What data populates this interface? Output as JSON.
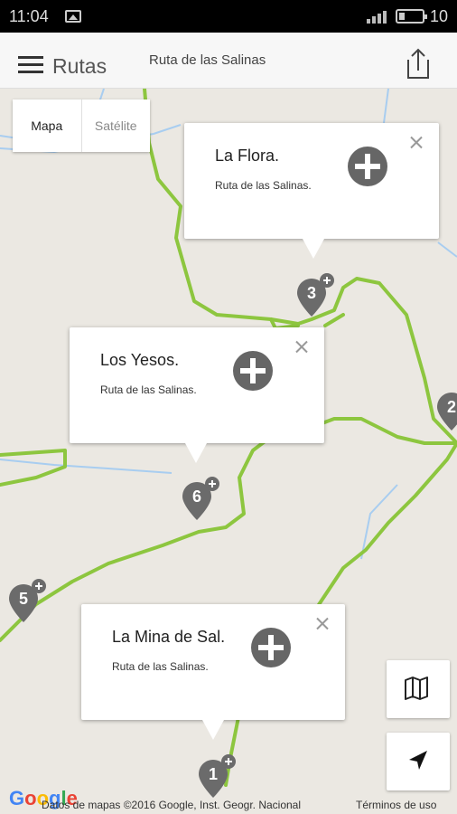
{
  "status": {
    "time": "11:04",
    "battery": "10"
  },
  "app_bar": {
    "title": "Rutas",
    "subtitle": "Ruta de las Salinas"
  },
  "map_type": {
    "map_label": "Mapa",
    "satellite_label": "Satélite",
    "selected": "Mapa"
  },
  "info_windows": [
    {
      "title": "La Flora.",
      "subtitle": "Ruta de las Salinas."
    },
    {
      "title": "Los Yesos.",
      "subtitle": "Ruta de las Salinas."
    },
    {
      "title": "La Mina de Sal.",
      "subtitle": "Ruta de las Salinas."
    }
  ],
  "markers": [
    "1",
    "2",
    "3",
    "5",
    "6"
  ],
  "footer": {
    "google_logo": "Google",
    "attribution": "Datos de mapas ©2016 Google, Inst. Geogr. Nacional",
    "terms": "Términos de uso"
  },
  "icons": {
    "menu": "menu-icon",
    "share": "share-icon",
    "map_layers": "map-icon",
    "my_location": "navigation-arrow-icon",
    "add": "plus-circle-icon",
    "close": "close-icon"
  },
  "colors": {
    "route": "#8dc63f",
    "water": "#a8cdf0",
    "marker": "#6b6b6b",
    "map_bg": "#ebe8e2"
  }
}
